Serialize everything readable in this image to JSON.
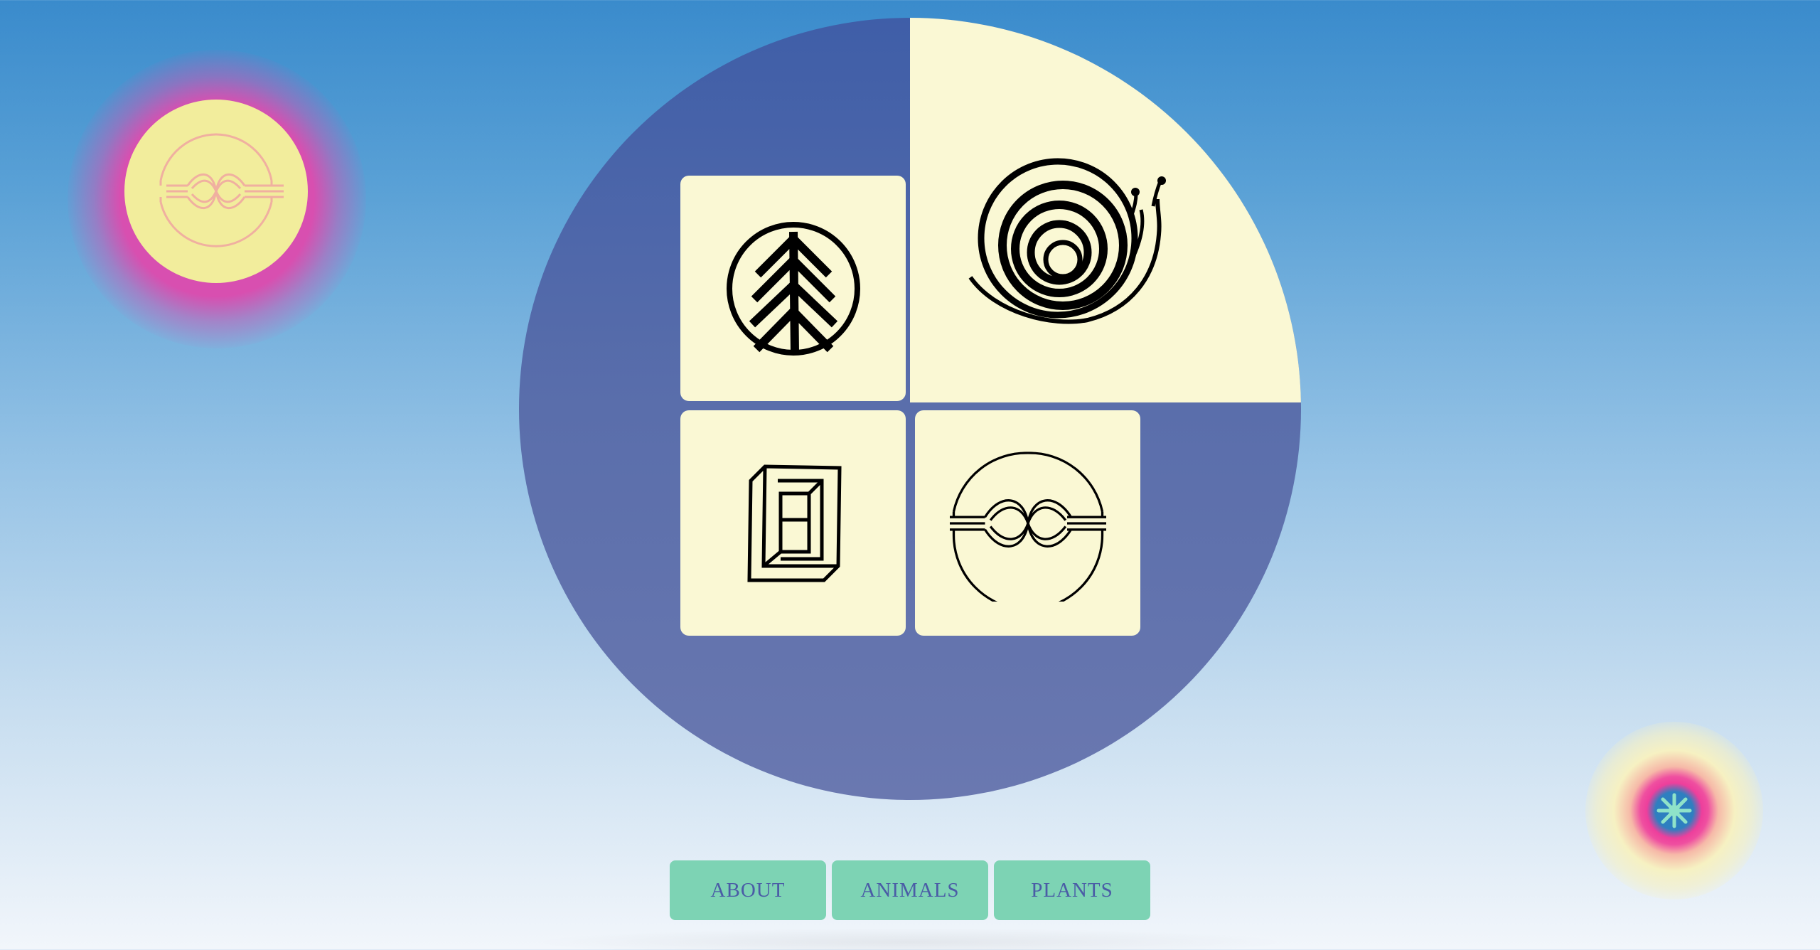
{
  "nav": {
    "items": [
      {
        "label": "ABOUT"
      },
      {
        "label": "ANIMALS"
      },
      {
        "label": "PLANTS"
      }
    ]
  },
  "icons": {
    "orb_left": "knot-icon",
    "orb_right": "flower-icon",
    "tile_1": "tree-icon",
    "tile_2": "snail-icon",
    "tile_3": "square-spiral-icon",
    "tile_4": "knot-icon"
  },
  "colors": {
    "circle": "#4f66a8",
    "tile": "#faf8d4",
    "nav_button": "#7dd3b4",
    "nav_text": "#4a5ca6",
    "orb_glow": "#d84fb0",
    "orb_core": "#f2ed9c"
  }
}
